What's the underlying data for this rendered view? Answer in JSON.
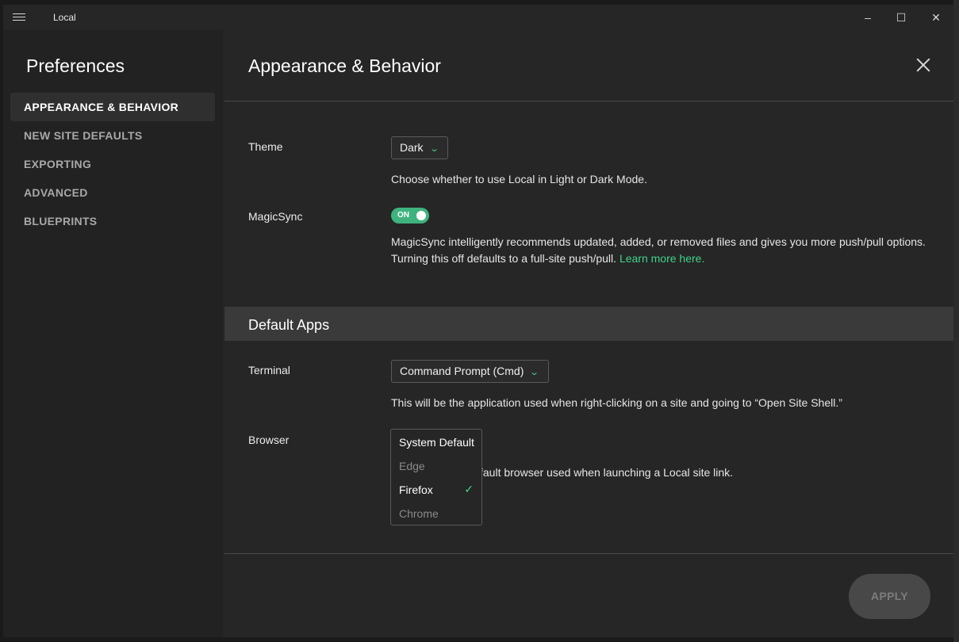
{
  "window": {
    "title": "Local"
  },
  "sidebar": {
    "heading": "Preferences",
    "items": [
      {
        "label": "APPEARANCE & BEHAVIOR",
        "active": true
      },
      {
        "label": "NEW SITE DEFAULTS",
        "active": false
      },
      {
        "label": "EXPORTING",
        "active": false
      },
      {
        "label": "ADVANCED",
        "active": false
      },
      {
        "label": "BLUEPRINTS",
        "active": false
      }
    ]
  },
  "main": {
    "heading": "Appearance & Behavior",
    "theme": {
      "label": "Theme",
      "value": "Dark",
      "description": "Choose whether to use Local in Light or Dark Mode."
    },
    "magicsync": {
      "label": "MagicSync",
      "toggle_text": "ON",
      "description_line1": "MagicSync intelligently recommends updated, added, or removed files and gives you more push/pull options.",
      "description_line2": "Turning this off defaults to a full-site push/pull.",
      "link_text": "Learn more here."
    },
    "default_apps": {
      "heading": "Default Apps",
      "terminal": {
        "label": "Terminal",
        "value": "Command Prompt (Cmd)",
        "description": "This will be the application used when right-clicking on a site and going to “Open Site Shell.”"
      },
      "browser": {
        "label": "Browser",
        "description_visible": "fault browser used when launching a Local site link.",
        "options": [
          "System Default",
          "Edge",
          "Firefox",
          "Chrome"
        ],
        "selected": "Firefox"
      }
    },
    "apply_label": "APPLY"
  },
  "colors": {
    "accent": "#3fd28a",
    "background": "#262626",
    "sidebar": "#222222"
  }
}
